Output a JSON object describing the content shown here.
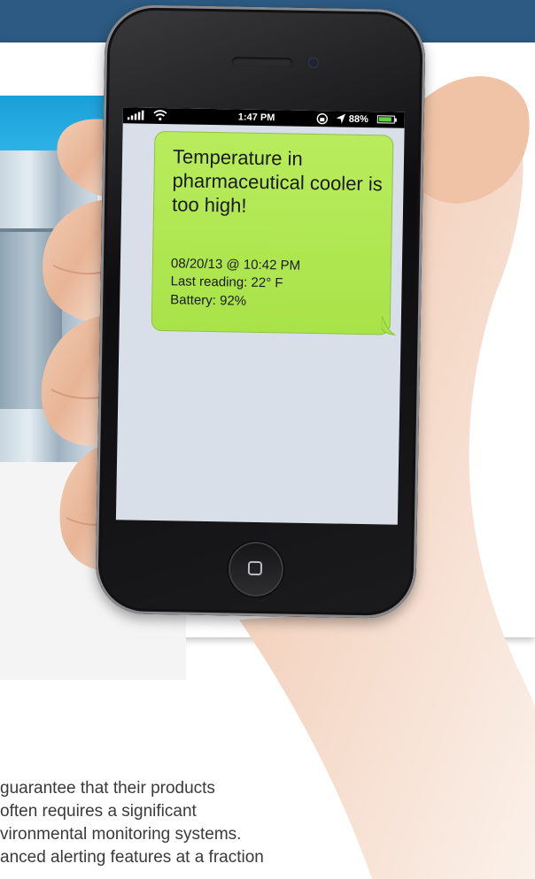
{
  "phone": {
    "status_bar": {
      "time": "1:47 PM",
      "battery_percent_label": "88%",
      "battery_level": 0.88,
      "icons": [
        "signal-icon",
        "wifi-icon",
        "rotation-lock-icon",
        "location-icon",
        "battery-icon"
      ]
    },
    "message": {
      "title": "Temperature in pharmaceutical cooler is too high!",
      "timestamp": "08/20/13 @ 10:42 PM",
      "last_reading": "Last reading: 22° F",
      "battery": "Battery: 92%",
      "bubble_color": "#b2e854"
    },
    "home_button_icon": "home-square-icon"
  },
  "colors": {
    "top_bar": "#2c5a82",
    "screen_background": "#d9dfe8"
  },
  "article": {
    "lines": [
      "guarantee that their products",
      "often requires a significant",
      "vironmental monitoring systems.",
      "anced alerting features at a fraction"
    ]
  }
}
